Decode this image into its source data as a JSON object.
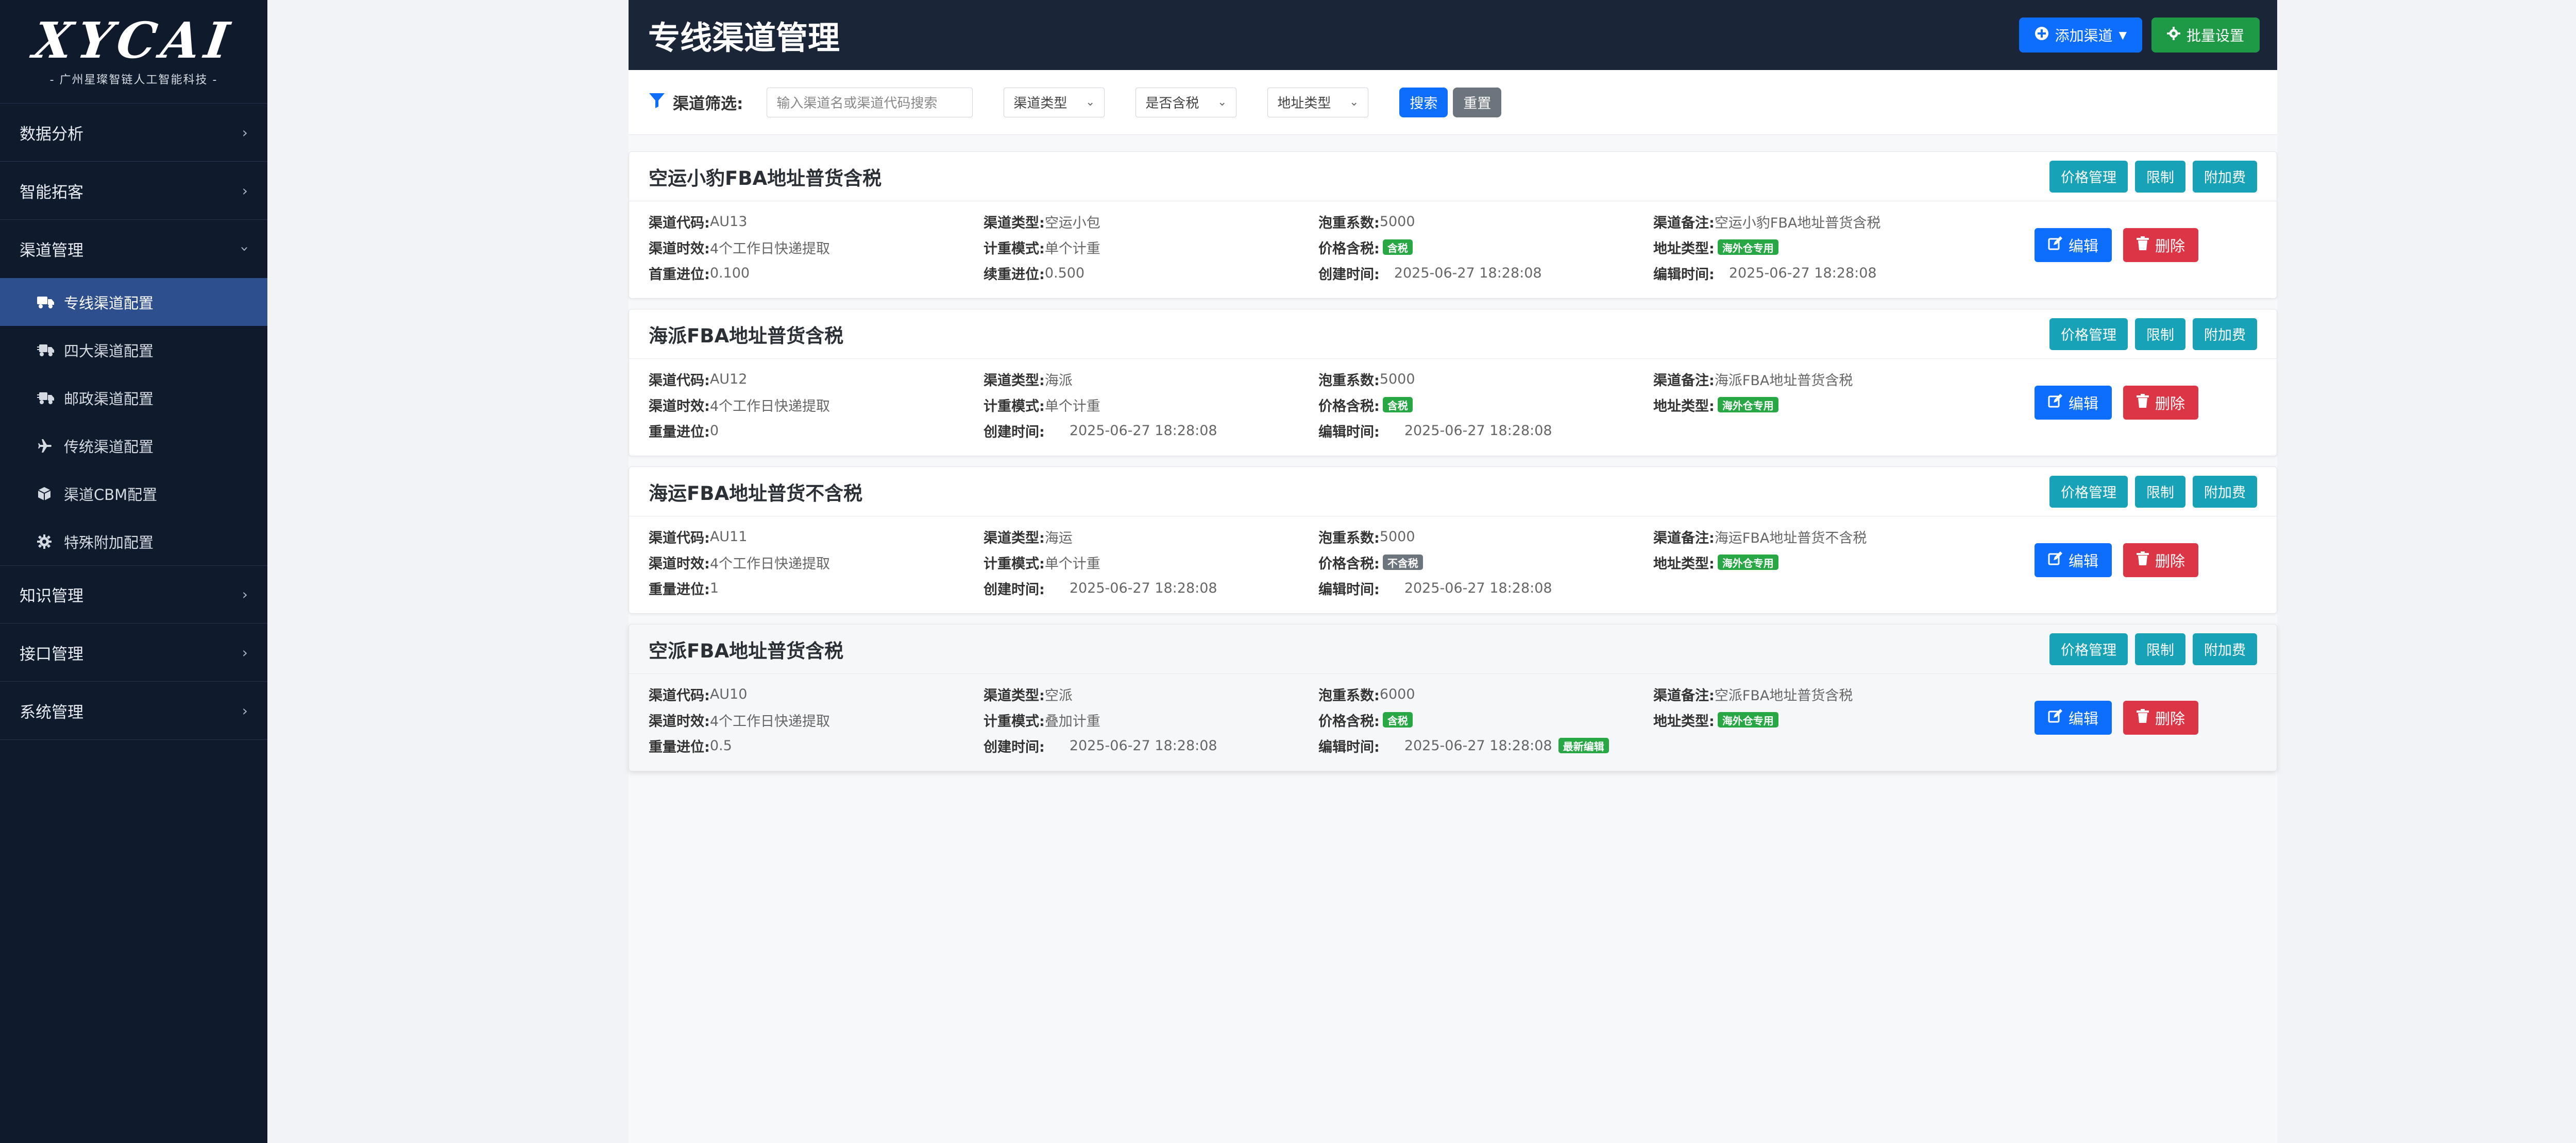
{
  "sidebar": {
    "logo": "XYCAI",
    "logo_sub": "- 广州星璨智链人工智能科技 -",
    "items": [
      {
        "label": "数据分析"
      },
      {
        "label": "智能拓客"
      },
      {
        "label": "渠道管理"
      },
      {
        "label": "知识管理"
      },
      {
        "label": "接口管理"
      },
      {
        "label": "系统管理"
      }
    ],
    "channel_sub": [
      {
        "label": "专线渠道配置",
        "icon": "truck-icon"
      },
      {
        "label": "四大渠道配置",
        "icon": "truck-fast-icon"
      },
      {
        "label": "邮政渠道配置",
        "icon": "truck-fast-icon"
      },
      {
        "label": "传统渠道配置",
        "icon": "plane-icon"
      },
      {
        "label": "渠道CBM配置",
        "icon": "box-icon"
      },
      {
        "label": "特殊附加配置",
        "icon": "gear-icon"
      }
    ]
  },
  "header": {
    "title": "专线渠道管理",
    "add_label": "添加渠道",
    "batch_label": "批量设置"
  },
  "filter": {
    "label": "渠道筛选:",
    "search_placeholder": "输入渠道名或渠道代码搜索",
    "type_select": "渠道类型",
    "tax_select": "是否含税",
    "addr_select": "地址类型",
    "search_btn": "搜索",
    "reset_btn": "重置"
  },
  "labels": {
    "price": "价格管理",
    "limit": "限制",
    "fee": "附加费",
    "edit": "编辑",
    "delete": "删除",
    "code": "渠道代码:",
    "time": "渠道时效:",
    "first_weight": "首重进位:",
    "weight": "重量进位:",
    "ctype": "渠道类型:",
    "mode": "计重模式:",
    "next_weight": "续重进位:",
    "created": "创建时间:",
    "factor": "泡重系数:",
    "tax": "价格含税:",
    "edited": "编辑时间:",
    "remark": "渠道备注:",
    "addr": "地址类型:"
  },
  "cards": [
    {
      "title": "空运小豹FBA地址普货含税",
      "code": "AU13",
      "ctype": "空运小包",
      "factor": "5000",
      "remark": "空运小豹FBA地址普货含税",
      "time": "4个工作日快递提取",
      "mode": "单个计重",
      "tax": "含税",
      "addr": "海外仓专用",
      "first_weight": "0.100",
      "next_weight": "0.500",
      "created": "2025-06-27 18:28:08",
      "edited": "2025-06-27 18:28:08"
    },
    {
      "title": "海派FBA地址普货含税",
      "code": "AU12",
      "ctype": "海派",
      "factor": "5000",
      "remark": "海派FBA地址普货含税",
      "time": "4个工作日快递提取",
      "mode": "单个计重",
      "tax": "含税",
      "addr": "海外仓专用",
      "weight": "0",
      "created": "2025-06-27 18:28:08",
      "edited": "2025-06-27 18:28:08"
    },
    {
      "title": "海运FBA地址普货不含税",
      "code": "AU11",
      "ctype": "海运",
      "factor": "5000",
      "remark": "海运FBA地址普货不含税",
      "time": "4个工作日快递提取",
      "mode": "单个计重",
      "tax": "不含税",
      "addr": "海外仓专用",
      "weight": "1",
      "created": "2025-06-27 18:28:08",
      "edited": "2025-06-27 18:28:08"
    },
    {
      "title": "空派FBA地址普货含税",
      "code": "AU10",
      "ctype": "空派",
      "factor": "6000",
      "remark": "空派FBA地址普货含税",
      "time": "4个工作日快递提取",
      "mode": "叠加计重",
      "tax": "含税",
      "addr": "海外仓专用",
      "weight": "0.5",
      "created": "2025-06-27 18:28:08",
      "edited": "2025-06-27 18:28:08",
      "latest": "最新编辑"
    }
  ],
  "colors": {
    "sidebar_bg": "#0f1a2c",
    "header_bg": "#1b2538",
    "primary": "#0d6efd",
    "success": "#1e9a46",
    "teal": "#17a2b8",
    "danger": "#dc3545"
  }
}
